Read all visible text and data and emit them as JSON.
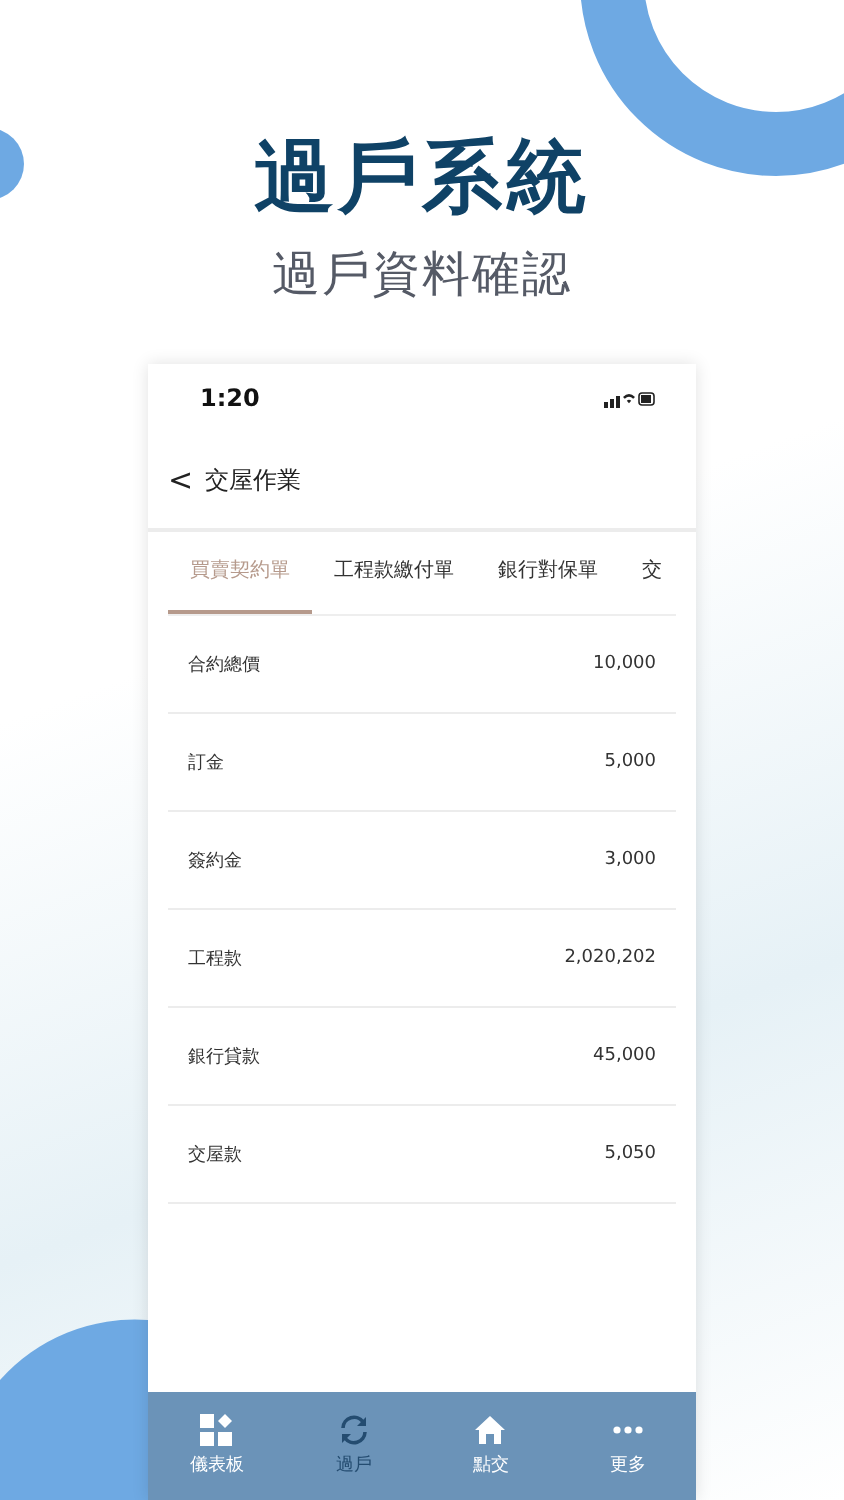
{
  "headline": {
    "title": "過戶系統",
    "subtitle": "過戶資料確認"
  },
  "status_bar": {
    "time": "1:20"
  },
  "header": {
    "back": "<",
    "title": "交屋作業"
  },
  "tabs": [
    {
      "label": "買賣契約單",
      "selected": true
    },
    {
      "label": "工程款繳付單",
      "selected": false
    },
    {
      "label": "銀行對保單",
      "selected": false
    },
    {
      "label": "交",
      "selected": false
    }
  ],
  "rows": [
    {
      "label": "合約總價",
      "value": "10,000"
    },
    {
      "label": "訂金",
      "value": "5,000"
    },
    {
      "label": "簽約金",
      "value": "3,000"
    },
    {
      "label": "工程款",
      "value": "2,020,202"
    },
    {
      "label": "銀行貸款",
      "value": "45,000"
    },
    {
      "label": "交屋款",
      "value": "5,050"
    }
  ],
  "bottom_nav": [
    {
      "kind": "dashboard",
      "label": "儀表板",
      "selected": false
    },
    {
      "kind": "sync",
      "label": "過戶",
      "selected": true
    },
    {
      "kind": "home",
      "label": "點交",
      "selected": false
    },
    {
      "kind": "more",
      "label": "更多",
      "selected": false
    }
  ]
}
